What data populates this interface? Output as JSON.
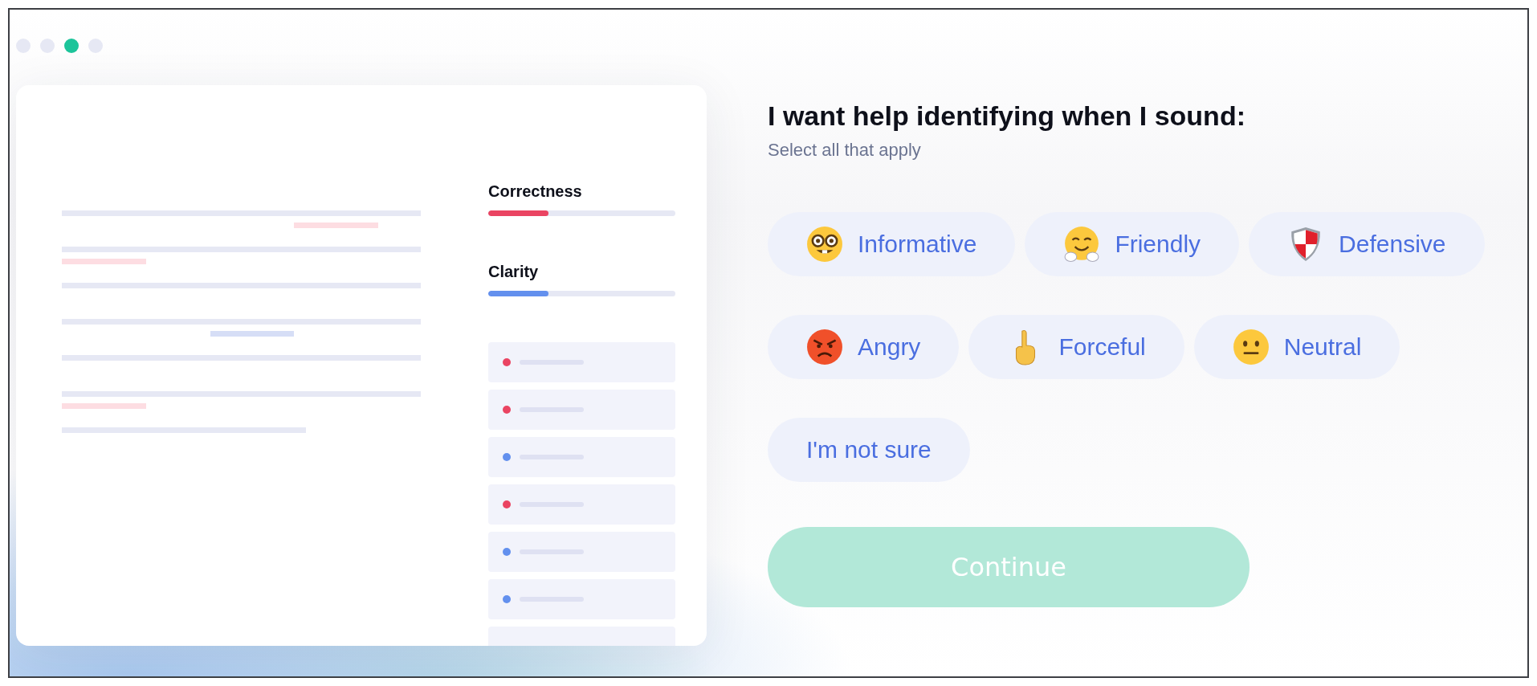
{
  "window_dots": [
    {
      "selected": false
    },
    {
      "selected": false
    },
    {
      "selected": true
    },
    {
      "selected": false
    }
  ],
  "preview": {
    "scores": [
      {
        "label": "Correctness",
        "level": 0.32,
        "color": "#ea4462"
      },
      {
        "label": "Clarity",
        "level": 0.32,
        "color": "#6390ee"
      }
    ],
    "suggestions": [
      {
        "kind": "issue",
        "color": "#ea4462"
      },
      {
        "kind": "issue",
        "color": "#ea4462"
      },
      {
        "kind": "issue",
        "color": "#6390ee"
      },
      {
        "kind": "issue",
        "color": "#ea4462"
      },
      {
        "kind": "issue",
        "color": "#6390ee"
      },
      {
        "kind": "issue",
        "color": "#6390ee"
      },
      {
        "kind": "blank"
      }
    ]
  },
  "title": "I want help identifying when I sound:",
  "subtitle": "Select all that apply",
  "tones": [
    [
      {
        "label": "Informative",
        "kind": "nerd",
        "selected": false
      },
      {
        "label": "Friendly",
        "kind": "hug",
        "selected": false
      },
      {
        "label": "Defensive",
        "kind": "shield",
        "selected": false
      }
    ],
    [
      {
        "label": "Angry",
        "kind": "angry",
        "selected": false
      },
      {
        "label": "Forceful",
        "kind": "point",
        "selected": false
      },
      {
        "label": "Neutral",
        "kind": "neutral",
        "selected": false
      }
    ],
    [
      {
        "label": "I'm not sure",
        "kind": "plain",
        "selected": false
      }
    ]
  ],
  "continue_button": {
    "label": "Continue",
    "disabled": true
  }
}
